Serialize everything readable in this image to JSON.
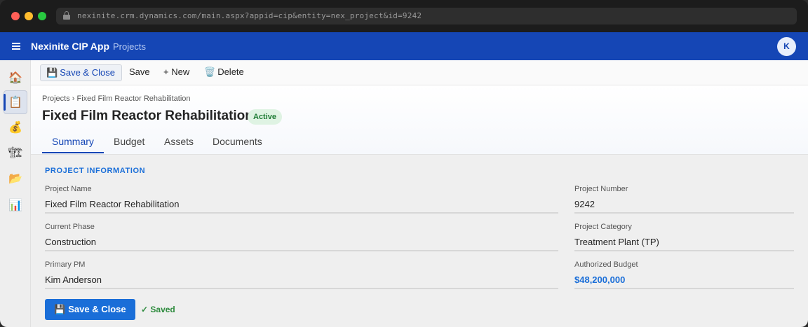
{
  "browser": {
    "url": "nexinite.crm.dynamics.com/main.aspx?appid=cip&entity=nex_project&id=9242"
  },
  "app": {
    "title": "Nexinite CIP App",
    "area": "Projects",
    "avatar_initial": "K",
    "accent": "#1546b5"
  },
  "leftnav": {
    "items": [
      {
        "icon": "home-icon",
        "glyph": "🏠"
      },
      {
        "icon": "projects-icon",
        "glyph": "📋",
        "active": true
      },
      {
        "icon": "budget-icon",
        "glyph": "💰"
      },
      {
        "icon": "construction-icon",
        "glyph": "🏗"
      },
      {
        "icon": "documents-icon",
        "glyph": "📂"
      },
      {
        "icon": "reports-icon",
        "glyph": "📊"
      }
    ]
  },
  "commandbar": {
    "save_close": "Save & Close",
    "save": "Save",
    "new": "+ New",
    "delete": "Delete"
  },
  "record": {
    "breadcrumb": "Projects › Fixed Film Reactor Rehabilitation",
    "title": "Fixed Film Reactor Rehabilitation",
    "status": "Active",
    "tabs": [
      "Summary",
      "Budget",
      "Assets",
      "Documents"
    ],
    "active_tab": "Summary"
  },
  "form": {
    "section_title": "PROJECT INFORMATION",
    "fields": {
      "project_name": {
        "label": "Project Name",
        "value": "Fixed Film Reactor Rehabilitation"
      },
      "current_phase": {
        "label": "Current Phase",
        "value": "Construction"
      },
      "primary_pm": {
        "label": "Primary PM",
        "value": "Kim Anderson"
      },
      "project_number": {
        "label": "Project Number",
        "value": "9242"
      },
      "project_category": {
        "label": "Project Category",
        "value": "Treatment Plant (TP)"
      },
      "authorized_budget": {
        "label": "Authorized Budget",
        "value": "$48,200,000"
      }
    },
    "save_close": "Save & Close",
    "saved_status": "✓ Saved"
  }
}
